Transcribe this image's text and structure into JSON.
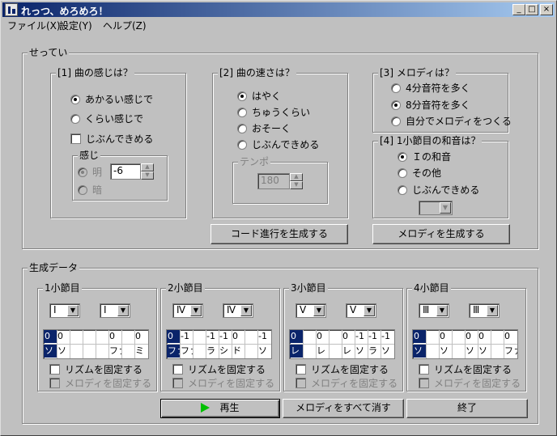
{
  "window": {
    "title": "れっつ、めろめろ！",
    "min": "_",
    "max": "□",
    "close": "×"
  },
  "menu": [
    "ファイル(X)",
    "設定(Y)",
    "ヘルプ(Z)"
  ],
  "settings": {
    "title": "せってい",
    "feel": {
      "title": "[1] 曲の感じは？",
      "options": [
        "あかるい感じで",
        "くらい感じで"
      ],
      "selected": 0,
      "checkbox": "じぶんできめる",
      "sub": {
        "title": "感じ",
        "options": [
          "明",
          "暗"
        ],
        "selected": 0,
        "value": "-6"
      }
    },
    "speed": {
      "title": "[2] 曲の速さは？",
      "options": [
        "はやく",
        "ちゅうくらい",
        "おそーく",
        "じぶんできめる"
      ],
      "selected": 0,
      "tempo": {
        "title": "テンポ",
        "value": "180"
      }
    },
    "melody": {
      "title": "[3] メロディは？",
      "options": [
        "4分音符を多く",
        "8分音符を多く",
        "自分でメロディをつくる"
      ],
      "selected": 1
    },
    "chord": {
      "title": "[4] 1小節目の和音は？",
      "options": [
        "Ｉの和音",
        "その他",
        "じぶんできめる"
      ],
      "selected": 0,
      "combo": ""
    },
    "gen_chord_button": "コード進行を生成する",
    "gen_melody_button": "メロディを生成する"
  },
  "generated": {
    "title": "生成データ",
    "measures": [
      {
        "title": "1小節目",
        "chords": [
          "I",
          "I"
        ],
        "rhythm": [
          "0",
          "0",
          "",
          "",
          "",
          "0",
          "",
          "0"
        ],
        "notes": [
          "ソ",
          "ソ",
          "",
          "",
          "",
          "ファ",
          "",
          "ミ"
        ],
        "rhythm_lock": "リズムを固定する",
        "melody_lock": "メロディを固定する"
      },
      {
        "title": "2小節目",
        "chords": [
          "Ⅳ",
          "Ⅳ"
        ],
        "rhythm": [
          "0",
          "-1",
          "",
          "-1",
          "-1",
          "0",
          "",
          "-1"
        ],
        "notes": [
          "ファ",
          "ファ",
          "",
          "ラ",
          "シ",
          "ド",
          "",
          "ソ"
        ],
        "rhythm_lock": "リズムを固定する",
        "melody_lock": "メロディを固定する"
      },
      {
        "title": "3小節目",
        "chords": [
          "Ⅴ",
          "Ⅴ"
        ],
        "rhythm": [
          "0",
          "",
          "0",
          "",
          "0",
          "-1",
          "-1",
          "-1"
        ],
        "notes": [
          "レ",
          "",
          "レ",
          "",
          "レ",
          "ソ",
          "ラ",
          "ソ"
        ],
        "rhythm_lock": "リズムを固定する",
        "melody_lock": "メロディを固定する"
      },
      {
        "title": "4小節目",
        "chords": [
          "Ⅲ",
          "Ⅲ"
        ],
        "rhythm": [
          "0",
          "",
          "0",
          "",
          "0",
          "0",
          "",
          "0"
        ],
        "notes": [
          "ソ",
          "",
          "ソ",
          "",
          "ソ",
          "ソ",
          "",
          "ファ"
        ],
        "rhythm_lock": "リズムを固定する",
        "melody_lock": "メロディを固定する"
      }
    ]
  },
  "buttons": {
    "play": "再生",
    "clear": "メロディをすべて消す",
    "exit": "終了"
  },
  "colors": {
    "title_start": "#0a246a",
    "title_end": "#a6caf0",
    "face": "#c0c0c0",
    "selection": "#0a246a",
    "play_icon": "#00c000"
  }
}
